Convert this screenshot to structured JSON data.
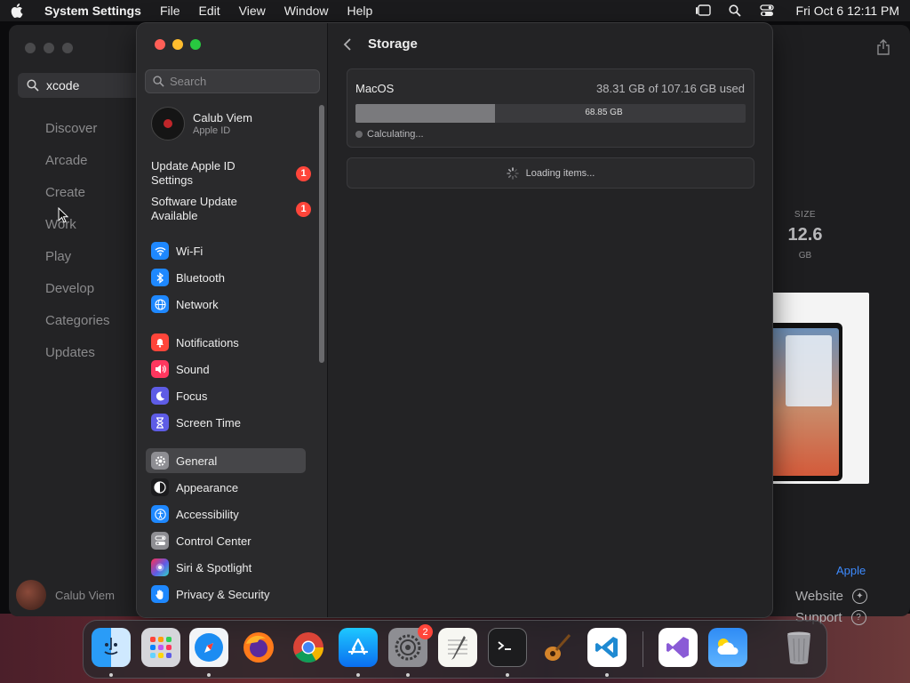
{
  "menubar": {
    "app_name": "System Settings",
    "items": [
      "File",
      "Edit",
      "View",
      "Window",
      "Help"
    ],
    "clock": "Fri Oct 6  12:11 PM"
  },
  "appstore": {
    "search_value": "xcode",
    "nav": [
      "Discover",
      "Arcade",
      "Create",
      "Work",
      "Play",
      "Develop",
      "Categories",
      "Updates"
    ],
    "user_name": "Calub Viem",
    "size_label": "SIZE",
    "size_value": "12.6",
    "size_unit": "GB",
    "developer_link": "Apple",
    "website_label": "Website",
    "support_label": "Support"
  },
  "settings": {
    "search_placeholder": "Search",
    "user": {
      "name": "Calub Viem",
      "subtitle": "Apple ID"
    },
    "alerts": [
      {
        "label": "Update Apple ID Settings",
        "badge": "1"
      },
      {
        "label": "Software Update Available",
        "badge": "1"
      }
    ],
    "items": [
      {
        "label": "Wi-Fi",
        "icon": "wifi-icon",
        "color": "#1e88ff"
      },
      {
        "label": "Bluetooth",
        "icon": "bluetooth-icon",
        "color": "#1e88ff"
      },
      {
        "label": "Network",
        "icon": "globe-icon",
        "color": "#1e88ff"
      },
      {
        "label": "Notifications",
        "icon": "bell-icon",
        "color": "#ff453a"
      },
      {
        "label": "Sound",
        "icon": "speaker-icon",
        "color": "#ff375f"
      },
      {
        "label": "Focus",
        "icon": "moon-icon",
        "color": "#5e5ce6"
      },
      {
        "label": "Screen Time",
        "icon": "hourglass-icon",
        "color": "#5e5ce6"
      },
      {
        "label": "General",
        "icon": "gear-icon",
        "color": "#8e8e93"
      },
      {
        "label": "Appearance",
        "icon": "appearance-icon",
        "color": "#1c1c1e"
      },
      {
        "label": "Accessibility",
        "icon": "accessibility-icon",
        "color": "#1e88ff"
      },
      {
        "label": "Control Center",
        "icon": "toggles-icon",
        "color": "#8e8e93"
      },
      {
        "label": "Siri & Spotlight",
        "icon": "siri-icon",
        "color": "#bf5af2"
      },
      {
        "label": "Privacy & Security",
        "icon": "hand-icon",
        "color": "#1e88ff"
      }
    ],
    "content": {
      "title": "Storage",
      "volume": "MacOS",
      "used_text": "38.31 GB of 107.16 GB used",
      "used_fraction": 0.3575,
      "free_text": "68.85 GB",
      "status": "Calculating...",
      "loading": "Loading items..."
    }
  },
  "dock": {
    "apps": [
      "Finder",
      "Launchpad",
      "Safari",
      "Firefox",
      "Chrome",
      "App Store",
      "System Settings",
      "TextEdit",
      "Terminal",
      "GarageBand",
      "Visual Studio Code",
      "Visual Studio",
      "Weather",
      "Trash"
    ],
    "settings_badge": "2"
  }
}
